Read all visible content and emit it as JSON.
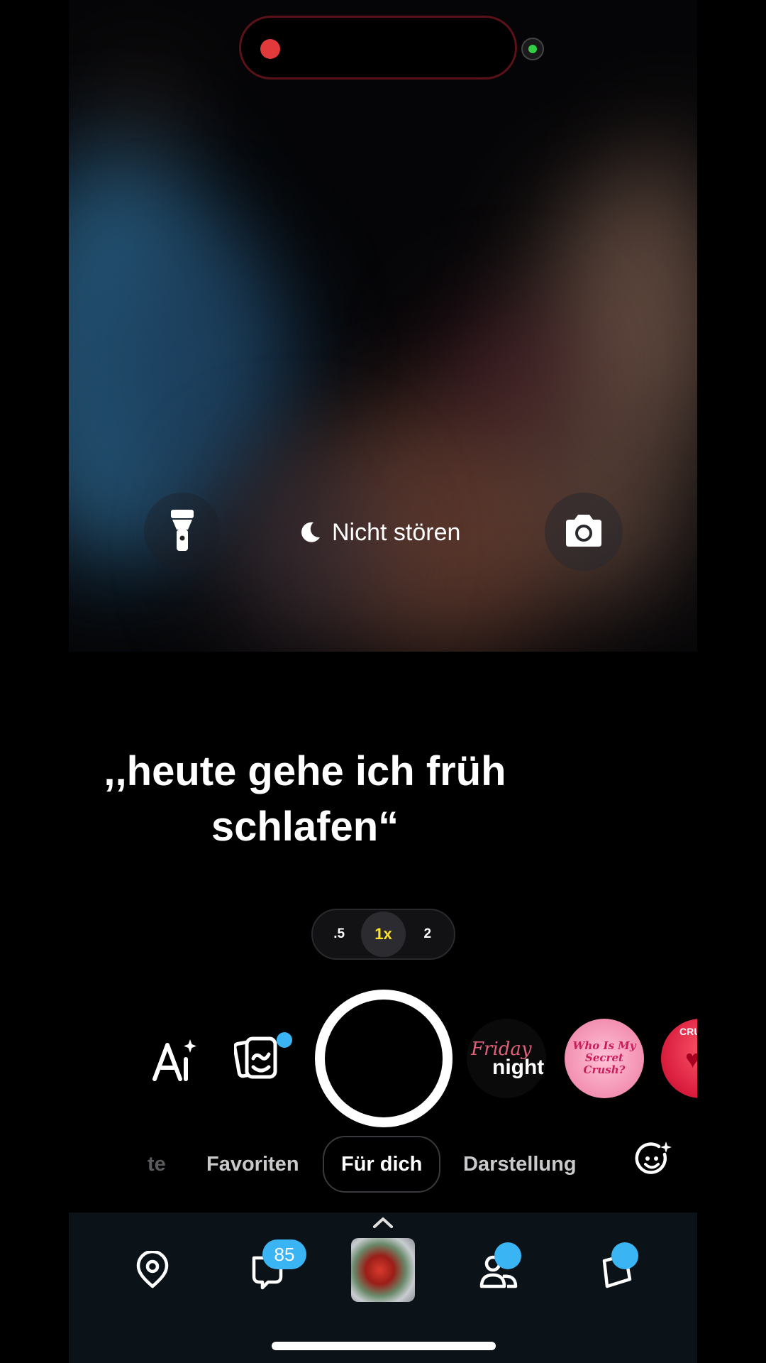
{
  "camera": {
    "do_not_disturb_label": "Nicht stören",
    "caption": ",,heute gehe ich früh schlafen“"
  },
  "zoom": {
    "options": [
      ".5",
      "1x",
      "2"
    ],
    "selected": "1x"
  },
  "lenses": {
    "friday_night": {
      "line1": "Friday",
      "line2": "night"
    },
    "secret_crush": {
      "text": "Who Is My Secret Crush?"
    },
    "crush": {
      "text": "CRU"
    }
  },
  "tabs": {
    "items": [
      "te",
      "Favoriten",
      "Für dich",
      "Darstellung"
    ],
    "active": "Für dich"
  },
  "nav": {
    "chat_badge": "85"
  },
  "colors": {
    "accent_blue": "#3ab4f2",
    "zoom_active": "#ffe326",
    "recording_red": "#e23a3a",
    "camera_indicator": "#33d047"
  },
  "icons": [
    "flashlight-icon",
    "moon-icon",
    "camera-flip-icon",
    "ai-sparkle-icon",
    "memories-icon",
    "lens-explore-icon",
    "map-pin-icon",
    "chat-icon",
    "chevron-up-icon",
    "friends-icon",
    "stories-icon"
  ]
}
